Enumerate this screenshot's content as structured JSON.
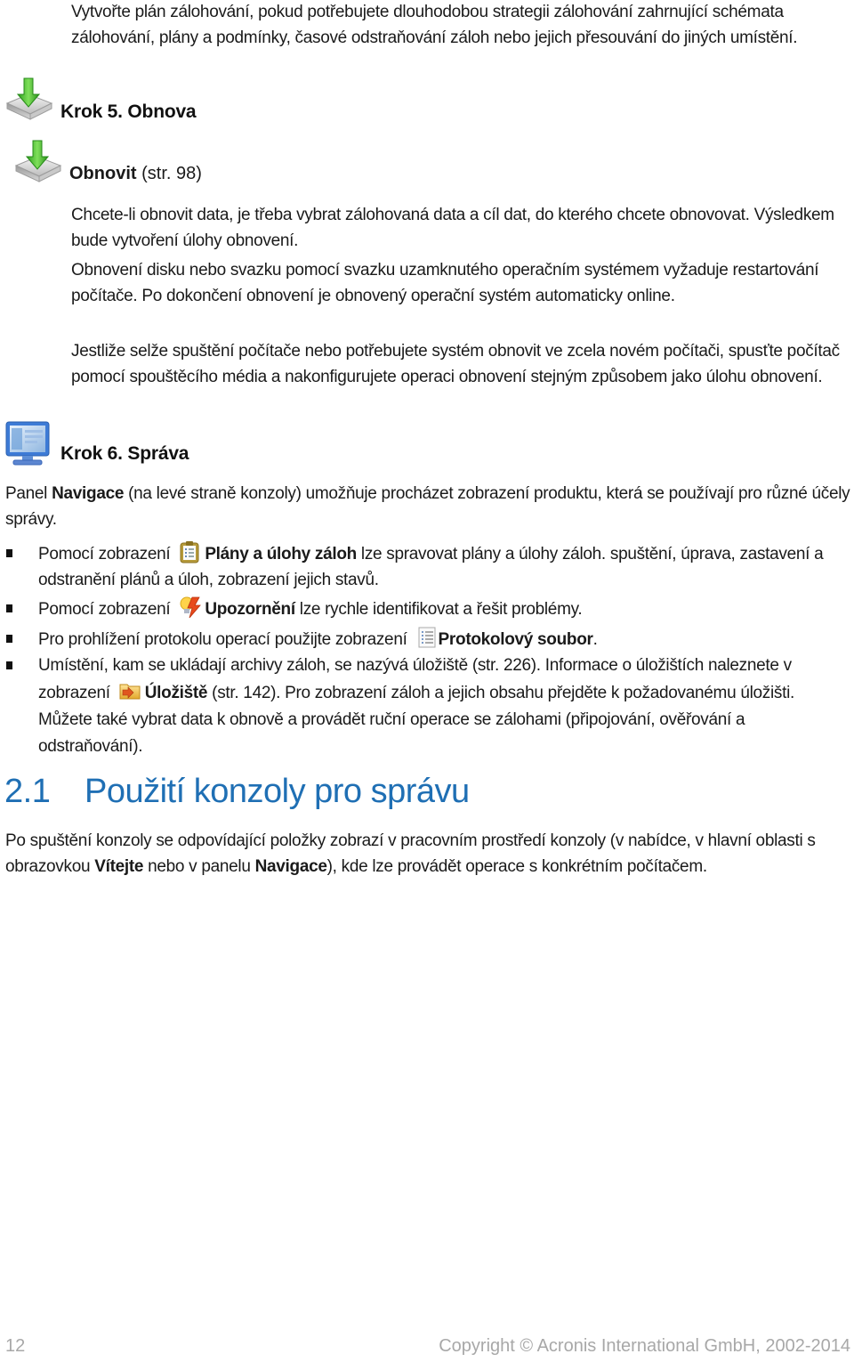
{
  "intro": {
    "text": "Vytvořte plán zálohování, pokud potřebujete dlouhodobou strategii zálohování zahrnující schémata zálohování, plány a podmínky, časové odstraňování záloh nebo jejich přesouvání do jiných umístění."
  },
  "step5": {
    "icon": "recover-disk-icon",
    "heading": "Krok 5. Obnova",
    "link_icon": "recover-disk-icon",
    "link_bold": "Obnovit",
    "link_ref": "(str. 98)",
    "paragraphs": [
      "Chcete-li obnovit data, je třeba vybrat zálohovaná data a cíl dat, do kterého chcete obnovovat. Výsledkem bude vytvoření úlohy obnovení.",
      "Obnovení disku nebo svazku pomocí svazku uzamknutého operačním systémem vyžaduje restartování počítače. Po dokončení obnovení je obnovený operační systém automaticky online.",
      "Jestliže selže spuštění počítače nebo potřebujete systém obnovit ve zcela novém počítači, spusťte počítač pomocí spouštěcího média a nakonfigurujete operaci obnovení stejným způsobem jako úlohu obnovení."
    ]
  },
  "step6": {
    "icon": "monitor-console-icon",
    "heading": "Krok 6. Správa",
    "panel_pre": "Panel ",
    "panel_bold": "Navigace",
    "panel_post": " (na levé straně konzoly) umožňuje procházet zobrazení produktu, která se používají pro různé účely správy.",
    "bullets": [
      {
        "pre": "Pomocí zobrazení ",
        "icon": "clipboard-plans-icon",
        "bold": "Plány a úlohy záloh",
        "post": " lze spravovat plány a úlohy záloh. spuštění, úprava, zastavení a odstranění plánů a úloh, zobrazení jejich stavů."
      },
      {
        "pre": "Pomocí zobrazení ",
        "icon": "alert-lightning-icon",
        "bold": "Upozornění",
        "post": " lze rychle identifikovat a řešit problémy."
      },
      {
        "pre": "Pro prohlížení protokolu operací použijte zobrazení ",
        "icon": "log-document-icon",
        "bold": "Protokolový soubor",
        "post": "."
      },
      {
        "pre": "Umístění, kam se ukládají archivy záloh, se nazývá úložiště (str. 226). Informace o úložištích naleznete v zobrazení ",
        "icon": "vault-folder-icon",
        "bold": "Úložiště",
        "post": " (str. 142). Pro zobrazení záloh a jejich obsahu přejděte k požadovanému úložišti. Můžete také vybrat data k obnově a provádět ruční operace se zálohami (připojování, ověřování a odstraňování)."
      }
    ]
  },
  "section": {
    "number": "2.1",
    "title": "Použití konzoly pro správu",
    "para_1": "Po spuštění konzoly se odpovídající položky zobrazí v pracovním prostředí konzoly (v nabídce, v hlavní oblasti s obrazovkou ",
    "bold_1": "Vítejte",
    "para_2": " nebo v panelu ",
    "bold_2": "Navigace",
    "para_3": "), kde lze provádět operace s konkrétním počítačem."
  },
  "footer": {
    "page_number": "12",
    "copyright": "Copyright © Acronis International GmbH, 2002-2014"
  },
  "colors": {
    "section_title": "#1f6fb4",
    "footer_text": "#a8a8a8",
    "body_text": "#1a1a1a"
  }
}
